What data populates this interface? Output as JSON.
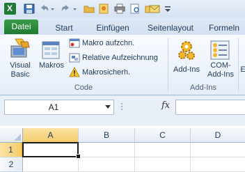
{
  "quick_access": {
    "icons": [
      "excel-logo-icon",
      "save-icon",
      "undo-icon",
      "undo-dropdown-icon",
      "redo-icon",
      "redo-dropdown-icon",
      "open-folder-icon",
      "new-icon",
      "print-icon",
      "print-preview-icon",
      "folder-icon",
      "email-icon",
      "customize-qat-icon"
    ]
  },
  "tabs": [
    {
      "label": "Datei"
    },
    {
      "label": "Start"
    },
    {
      "label": "Einfügen"
    },
    {
      "label": "Seitenlayout"
    },
    {
      "label": "Formeln"
    }
  ],
  "ribbon": {
    "code_group": {
      "label": "Code",
      "visual_basic": [
        "Visual",
        "Basic"
      ],
      "macros": "Makros",
      "record_macro": "Makro aufzchn.",
      "relative_record": "Relative Aufzeichnung",
      "macro_security": "Makrosicherh."
    },
    "addins_group": {
      "label": "Add-Ins",
      "addins": "Add-Ins",
      "com_addins": [
        "COM-",
        "Add-Ins"
      ],
      "partial_next": "E"
    }
  },
  "formula_bar": {
    "name_box": "A1",
    "fx": "fx",
    "formula": ""
  },
  "sheet": {
    "columns": [
      "A",
      "B",
      "C",
      "D"
    ],
    "rows": [
      "1",
      "2"
    ],
    "active_cell": "A1"
  },
  "colors": {
    "file_tab": "#2a8a3a",
    "accent_header": "#f8d87a",
    "active_cell_border": "#1a1a1a"
  }
}
